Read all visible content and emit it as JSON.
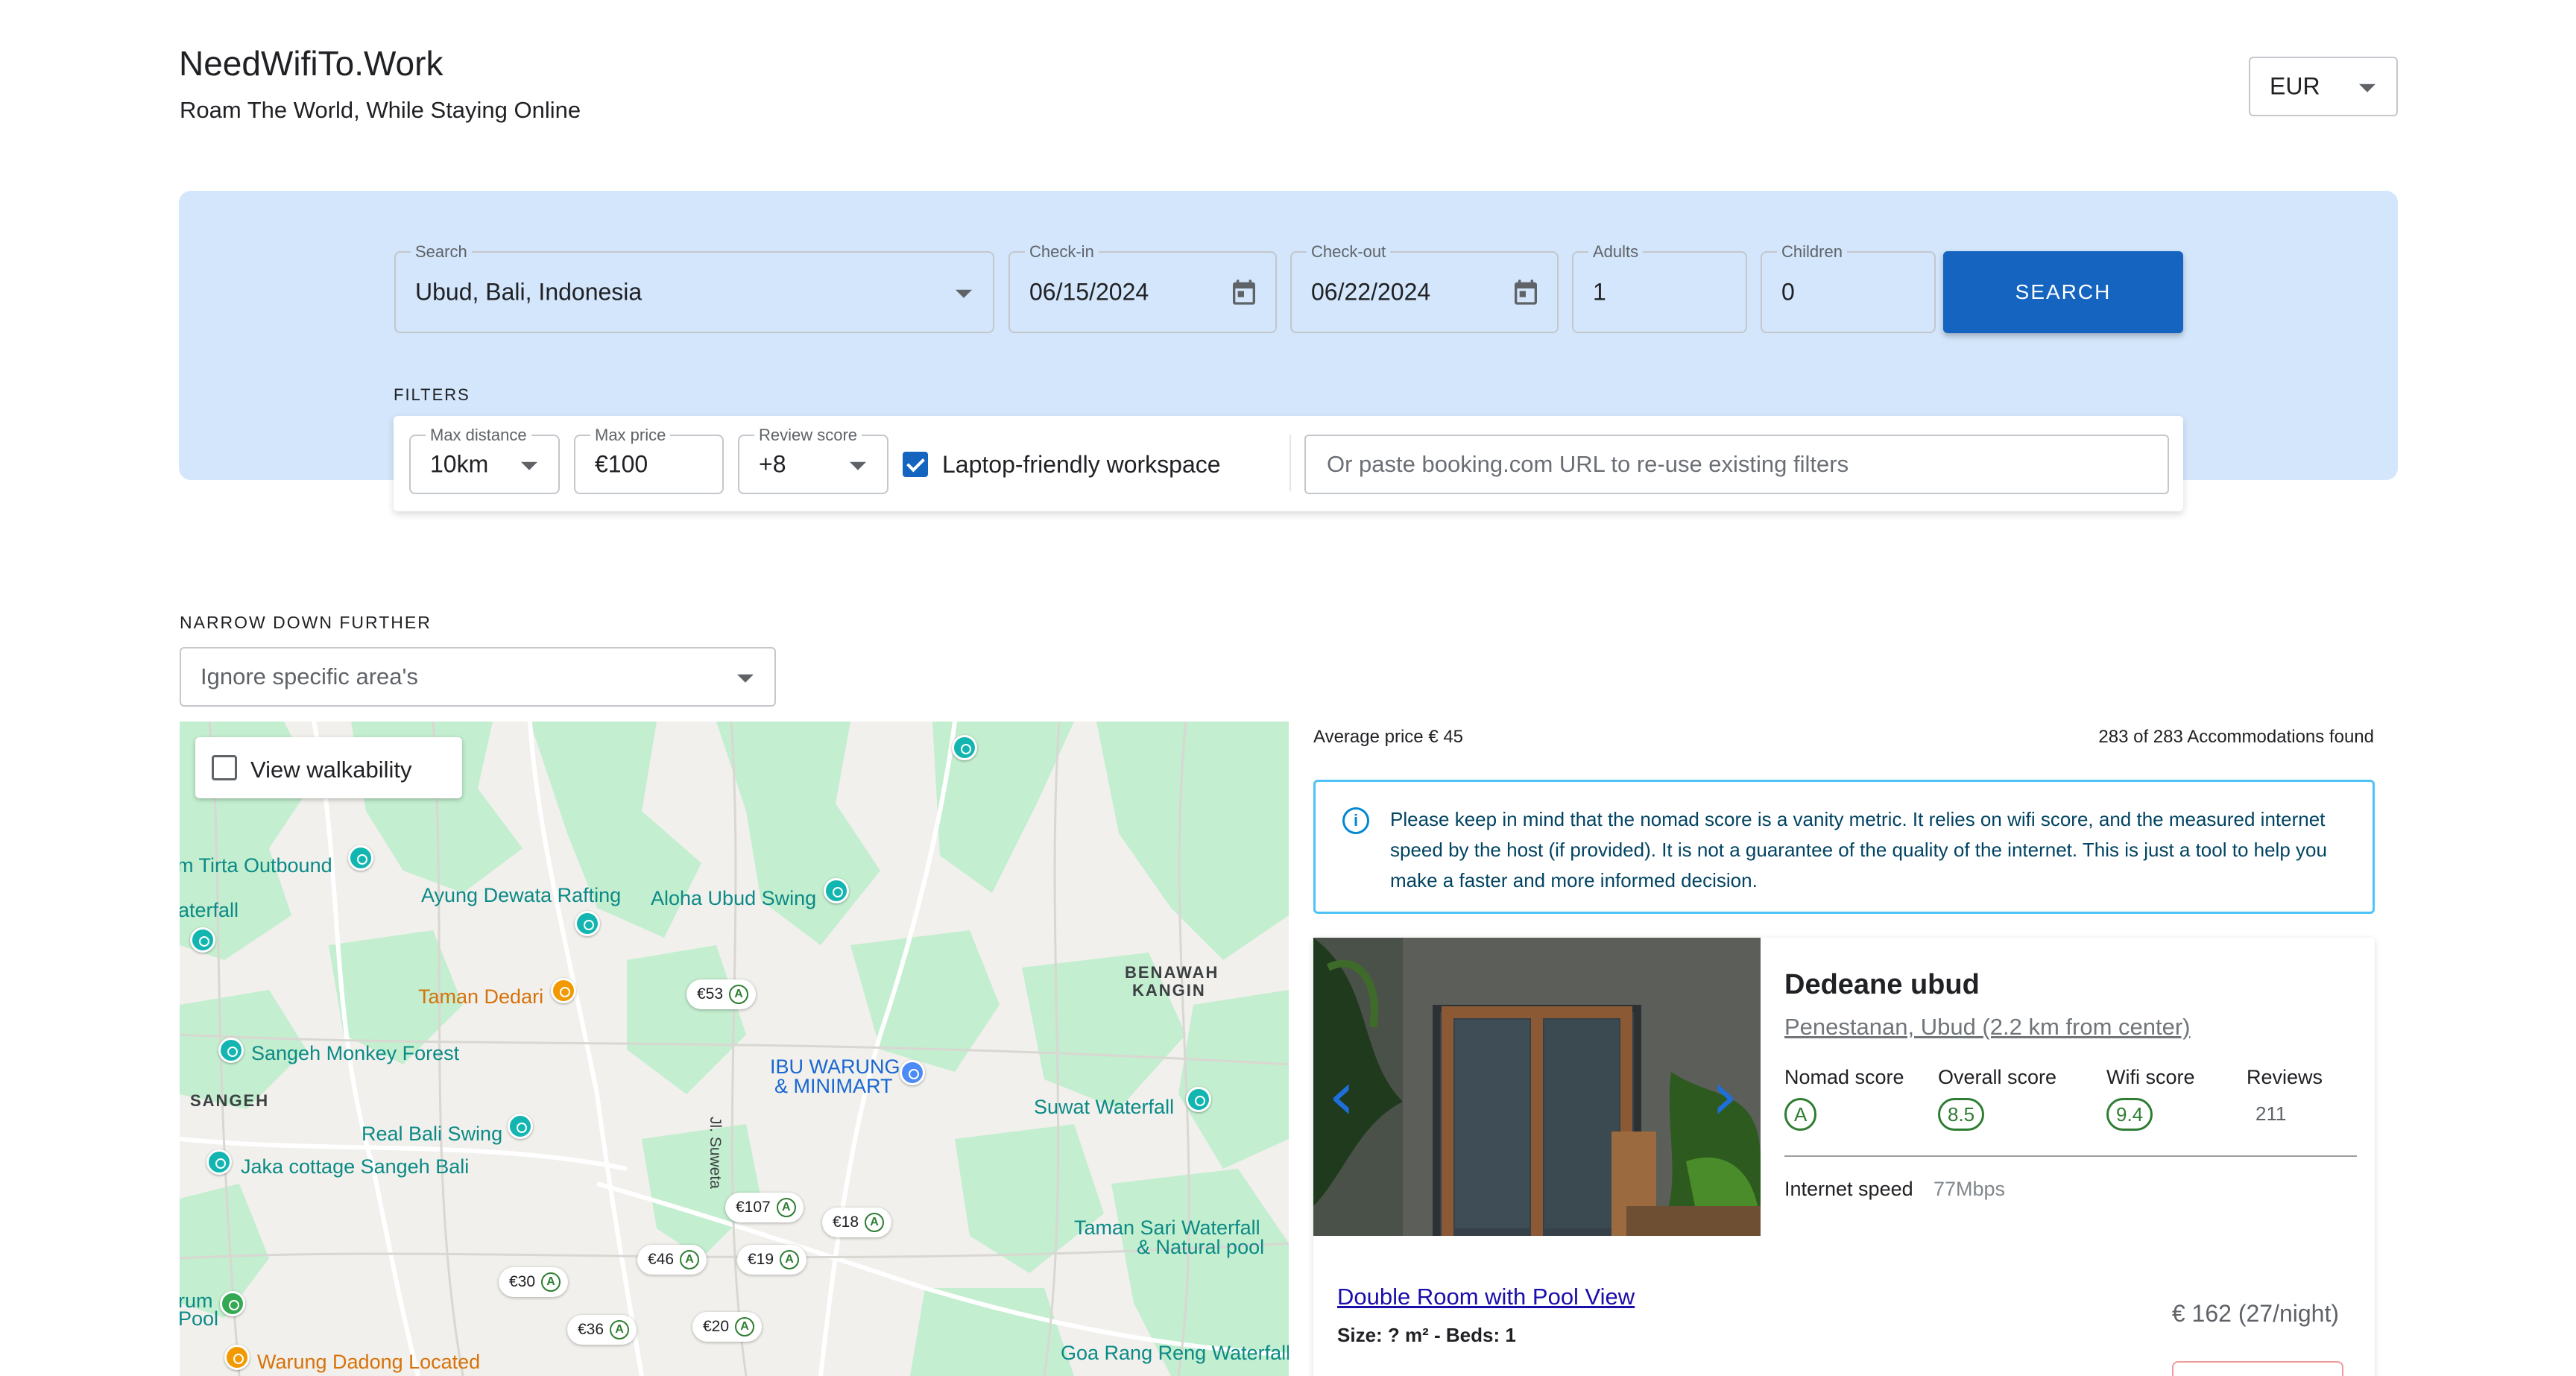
{
  "header": {
    "title": "NeedWifiTo.Work",
    "tagline": "Roam The World, While Staying Online",
    "currency": "EUR"
  },
  "search": {
    "location_label": "Search",
    "location_value": "Ubud, Bali, Indonesia",
    "checkin_label": "Check-in",
    "checkin_value": "06/15/2024",
    "checkout_label": "Check-out",
    "checkout_value": "06/22/2024",
    "adults_label": "Adults",
    "adults_value": "1",
    "children_label": "Children",
    "children_value": "0",
    "button_label": "SEARCH"
  },
  "filters": {
    "section_label": "FILTERS",
    "max_distance_label": "Max distance",
    "max_distance_value": "10km",
    "max_price_label": "Max price",
    "max_price_value": "€100",
    "review_score_label": "Review score",
    "review_score_value": "+8",
    "laptop_label": "Laptop-friendly workspace",
    "laptop_checked": true,
    "url_placeholder": "Or paste booking.com URL to re-use existing filters"
  },
  "narrow": {
    "section_label": "NARROW DOWN FURTHER",
    "area_placeholder": "Ignore specific area's"
  },
  "map": {
    "walkability_label": "View walkability",
    "places": {
      "tirta": "m Tirta Outbound",
      "waterfall_left": "aterfall",
      "ayung": "Ayung Dewata Rafting",
      "aloha": "Aloha Ubud Swing",
      "tamandedari": "Taman Dedari",
      "benawah_1": "BENAWAH",
      "benawah_2": "KANGIN",
      "sangeh_forest": "Sangeh Monkey Forest",
      "sangeh": "SANGEH",
      "ibu_1": "IBU WARUNG",
      "ibu_2": "& MINIMART",
      "suwat": "Suwat Waterfall",
      "street": "Jl. Suweta",
      "realbali": "Real Bali Swing",
      "jaka": "Jaka cottage Sangeh Bali",
      "tamansari_1": "Taman Sari Waterfall",
      "tamansari_2": "& Natural pool",
      "rum_1": "rum",
      "rum_2": "Pool",
      "warung": "Warung Dadong Located",
      "goa": "Goa Rang Reng Waterfall"
    },
    "prices": {
      "p1": "€53",
      "p2": "€107",
      "p3": "€18",
      "p4": "€46",
      "p5": "€19",
      "p6": "€30",
      "p7": "€36",
      "p8": "€20"
    },
    "grade": "A"
  },
  "results": {
    "avg_price": "Average price € 45",
    "found": "283 of 283 Accommodations found",
    "info": "Please keep in mind that the nomad score is a vanity metric. It relies on wifi score, and the measured internet speed by the host (if provided). It is not a guarantee of the quality of the internet. This is just a tool to help you make a faster and more informed decision.",
    "card": {
      "name": "Dedeane ubud",
      "location": "Penestanan, Ubud (2.2 km from center)",
      "nomad_label": "Nomad score",
      "nomad_value": "A",
      "overall_label": "Overall score",
      "overall_value": "8.5",
      "wifi_label": "Wifi score",
      "wifi_value": "9.4",
      "reviews_label": "Reviews",
      "reviews_value": "211",
      "speed_label": "Internet speed",
      "speed_value": "77Mbps",
      "room_name": "Double Room with Pool View",
      "room_meta": "Size: ? m² - Beds: 1",
      "room_price": "€ 162 (27/night)"
    }
  },
  "colors": {
    "accent": "#1565c0",
    "panel": "#d3e6fb",
    "info_border": "#4fc3f7",
    "score_green": "#2e7d32"
  }
}
